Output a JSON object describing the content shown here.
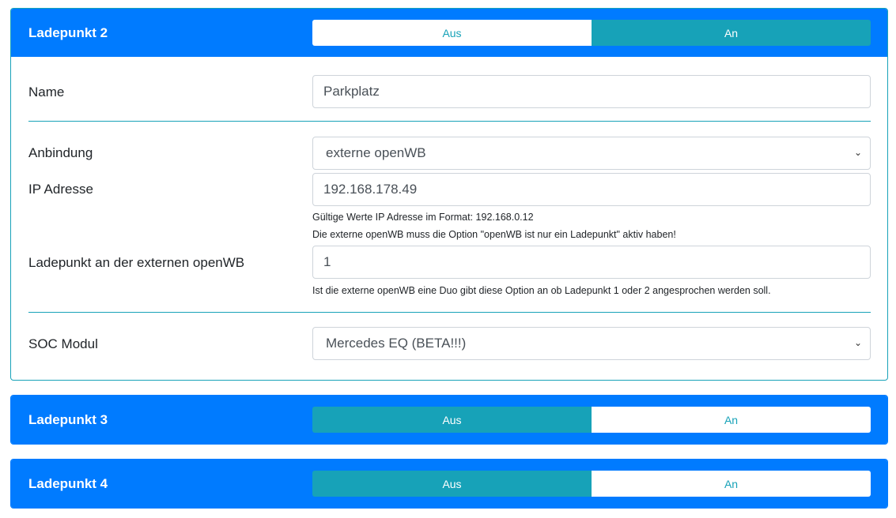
{
  "cards": [
    {
      "title": "Ladepunkt 2",
      "off": "Aus",
      "on": "An",
      "state": "on"
    },
    {
      "title": "Ladepunkt 3",
      "off": "Aus",
      "on": "An",
      "state": "off"
    },
    {
      "title": "Ladepunkt 4",
      "off": "Aus",
      "on": "An",
      "state": "off"
    }
  ],
  "form": {
    "name_label": "Name",
    "name_value": "Parkplatz",
    "anbindung_label": "Anbindung",
    "anbindung_value": "externe openWB",
    "ip_label": "IP Adresse",
    "ip_value": "192.168.178.49",
    "ip_hint1": "Gültige Werte IP Adresse im Format: 192.168.0.12",
    "ip_hint2": "Die externe openWB muss die Option \"openWB ist nur ein Ladepunkt\" aktiv haben!",
    "lp_label": "Ladepunkt an der externen openWB",
    "lp_value": "1",
    "lp_hint": "Ist die externe openWB eine Duo gibt diese Option an ob Ladepunkt 1 oder 2 angesprochen werden soll.",
    "soc_label": "SOC Modul",
    "soc_value": "Mercedes EQ (BETA!!!)"
  }
}
